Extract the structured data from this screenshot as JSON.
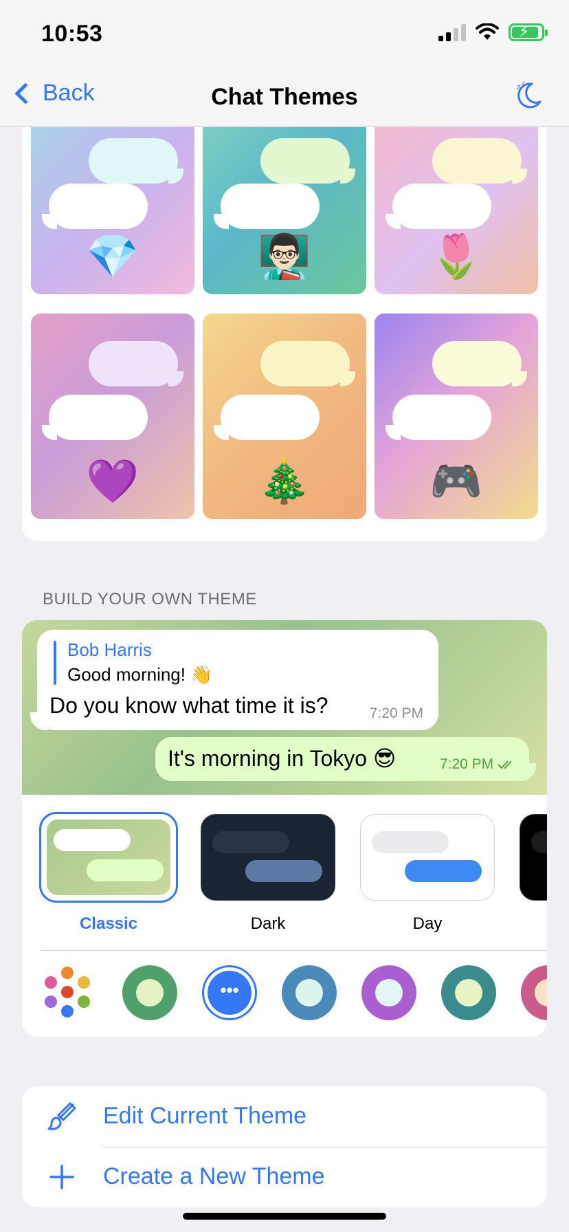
{
  "status_bar": {
    "time": "10:53"
  },
  "nav": {
    "back_label": "Back",
    "title": "Chat Themes"
  },
  "themes_grid": {
    "tiles": [
      {
        "emoji": "💎",
        "out_color": "#dff7f7",
        "bg": "linear-gradient(135deg,#a7d5e8 0%,#c7b3ee 50%,#f2b9dc 100%)"
      },
      {
        "emoji": "👨🏻‍🏫",
        "out_color": "#e4f8cf",
        "bg": "linear-gradient(135deg,#7fd0c0 0%,#5ab8c9 45%,#6cc79a 100%)"
      },
      {
        "emoji": "🌷",
        "out_color": "#fbf5d2",
        "bg": "linear-gradient(135deg,#f4b8c9 0%,#dfc1f0 55%,#f0c0a4 100%)"
      },
      {
        "emoji": "💜",
        "out_color": "#efe3fb",
        "bg": "linear-gradient(135deg,#e4a1c8 0%,#c99cd8 45%,#efc4a9 100%)"
      },
      {
        "emoji": "🎄",
        "out_color": "#fbf4c7",
        "bg": "linear-gradient(135deg,#f4d88c 0%,#f1b880 50%,#f0a877 100%)"
      },
      {
        "emoji": "🎮",
        "out_color": "#fbfad9",
        "bg": "linear-gradient(135deg,#9b84f0 0%,#e4a4d8 45%,#f1dc8c 100%)"
      }
    ]
  },
  "builder": {
    "section_title": "BUILD YOUR OWN THEME",
    "preview": {
      "reply_name": "Bob Harris",
      "reply_text": "Good morning! 👋",
      "incoming_text": "Do you know what time it is?",
      "incoming_time": "7:20 PM",
      "outgoing_text": "It's morning in Tokyo 😎",
      "outgoing_time": "7:20 PM",
      "read_icon": "double-check-icon"
    },
    "presets": [
      {
        "label": "Classic",
        "selected": true
      },
      {
        "label": "Dark",
        "selected": false
      },
      {
        "label": "Day",
        "selected": false
      }
    ],
    "accent_colors": [
      {
        "ring": "#4fa06a",
        "center": "#e4f2c4"
      },
      {
        "ring": "#3478f6",
        "center": "#ffffff",
        "selected": true,
        "symbol": "•••"
      },
      {
        "ring": "#4b8ab8",
        "center": "#ddf5ef"
      },
      {
        "ring": "#a95fcf",
        "center": "#e2f6f6"
      },
      {
        "ring": "#3a8c8c",
        "center": "#e8f2c2"
      },
      {
        "ring": "#c95c88",
        "center": "#f6e3c6"
      }
    ]
  },
  "actions": [
    {
      "label": "Edit Current Theme",
      "icon": "brush-icon"
    },
    {
      "label": "Create a New Theme",
      "icon": "plus-icon"
    }
  ]
}
